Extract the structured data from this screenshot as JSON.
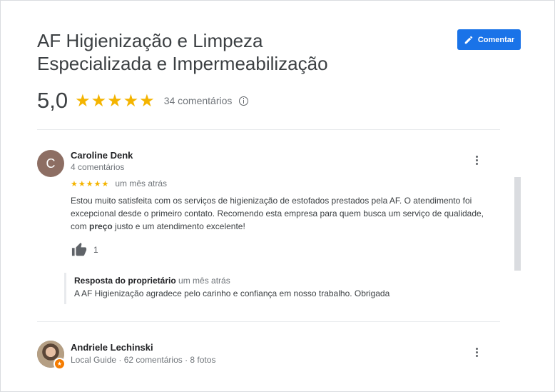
{
  "place": {
    "title_line1": "AF Higienização e Limpeza",
    "title_line2": "Especializada e Impermeabilização",
    "comment_button": "Comentar",
    "score": "5,0",
    "stars": "★★★★★",
    "reviews_count": "34 comentários",
    "rating_value": 5
  },
  "reviews": [
    {
      "avatar_letter": "C",
      "name": "Caroline Denk",
      "meta": "4 comentários",
      "stars": "★★★★★",
      "time": "um mês atrás",
      "text_part1": "Estou muito satisfeita com os serviços de higienização de estofados prestados pela AF. O atendimento foi excepcional desde o primeiro contato. Recomendo esta empresa para quem busca um serviço de qualidade, com ",
      "text_bold": "preço",
      "text_part2": " justo e um atendimento excelente!",
      "likes": "1",
      "reply": {
        "label": "Resposta do proprietário",
        "time": "um mês atrás",
        "text": "A AF Higienização agradece pelo carinho e confiança em nosso trabalho. Obrigada"
      }
    },
    {
      "name": "Andriele Lechinski",
      "meta": "Local Guide · 62 comentários · 8 fotos"
    }
  ],
  "colors": {
    "accent": "#1a73e8",
    "star": "#f4b400",
    "avatar_c": "#8d6e63"
  },
  "icons": [
    "pencil-icon",
    "info-icon",
    "thumbs-up-icon",
    "more-vert-icon",
    "local-guide-icon"
  ]
}
